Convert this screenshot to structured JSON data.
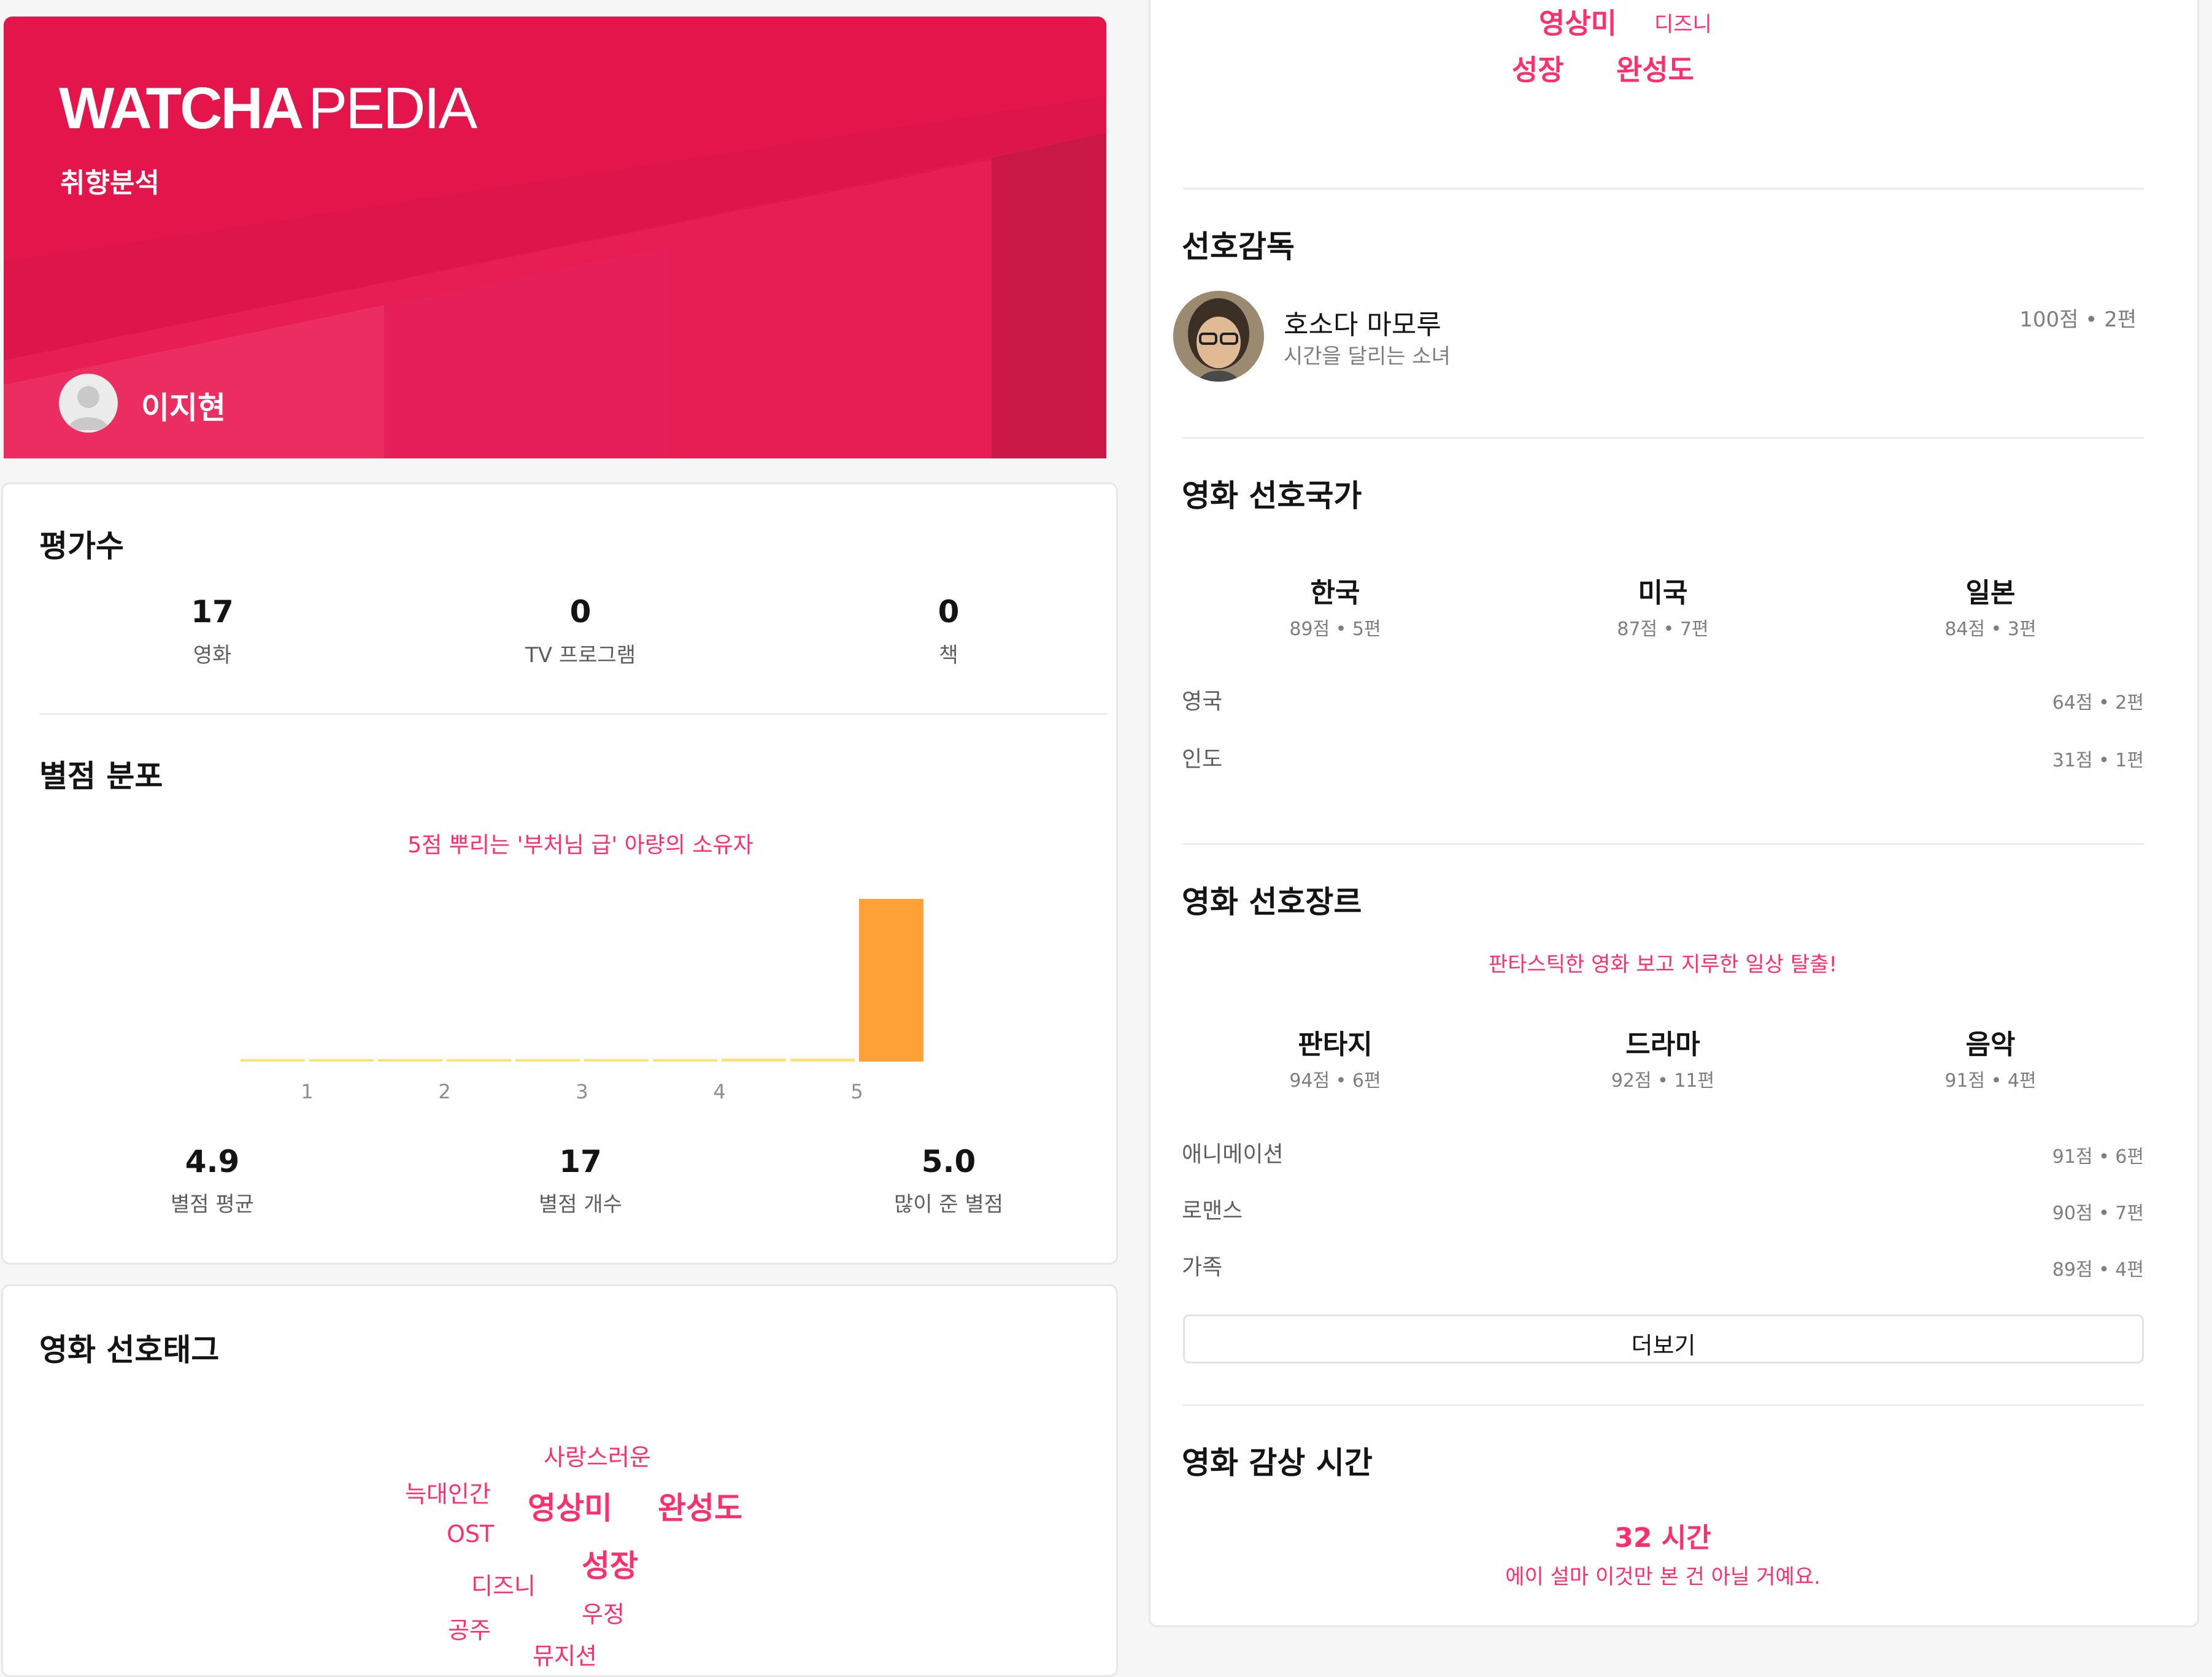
{
  "header": {
    "brand_watcha": "WATCHA",
    "brand_pedia": "PEDIA",
    "subtitle": "취향분석",
    "user_name": "이지현",
    "avatar_icon": "user-avatar-icon",
    "colors": {
      "primary": "#e4154b",
      "accent": "#ff2f6e"
    }
  },
  "ratings_count": {
    "title": "평가수",
    "items": [
      {
        "value": "17",
        "label": "영화"
      },
      {
        "value": "0",
        "label": "TV 프로그램"
      },
      {
        "value": "0",
        "label": "책"
      }
    ]
  },
  "star_distribution": {
    "title": "별점 분포",
    "comment": "5점 뿌리는 '부처님 급' 아량의 소유자",
    "stats": [
      {
        "value": "4.9",
        "label": "별점 평균"
      },
      {
        "value": "17",
        "label": "별점 개수"
      },
      {
        "value": "5.0",
        "label": "많이 준 별점"
      }
    ]
  },
  "chart_data": {
    "type": "bar",
    "categories": [
      "0.5",
      "1",
      "1.5",
      "2",
      "2.5",
      "3",
      "3.5",
      "4",
      "4.5",
      "5"
    ],
    "values": [
      0,
      0,
      0,
      0,
      0,
      0,
      0,
      0.3,
      0.3,
      16
    ],
    "tick_labels": [
      "1",
      "2",
      "3",
      "4",
      "5"
    ],
    "highlight_color": "#ffa136",
    "base_color": "#fde17a",
    "ylim": [
      0,
      16
    ]
  },
  "tags": {
    "title": "영화 선호태그",
    "items": [
      "사랑스러운",
      "늑대인간",
      "영상미",
      "완성도",
      "OST",
      "성장",
      "디즈니",
      "우정",
      "공주",
      "뮤지션"
    ]
  },
  "tags_top": {
    "items": [
      "영상미",
      "디즈니",
      "성장",
      "완성도"
    ]
  },
  "director": {
    "title": "선호감독",
    "name": "호소다 마모루",
    "work": "시간을 달리는 소녀",
    "stat": "100점 • 2편"
  },
  "countries": {
    "title": "영화 선호국가",
    "top": [
      {
        "name": "한국",
        "stat": "89점 • 5편"
      },
      {
        "name": "미국",
        "stat": "87점 • 7편"
      },
      {
        "name": "일본",
        "stat": "84점 • 3편"
      }
    ],
    "rest": [
      {
        "name": "영국",
        "stat": "64점 • 2편"
      },
      {
        "name": "인도",
        "stat": "31점 • 1편"
      }
    ]
  },
  "genres": {
    "title": "영화 선호장르",
    "comment": "판타스틱한 영화 보고 지루한 일상 탈출!",
    "top": [
      {
        "name": "판타지",
        "stat": "94점 • 6편"
      },
      {
        "name": "드라마",
        "stat": "92점 • 11편"
      },
      {
        "name": "음악",
        "stat": "91점 • 4편"
      }
    ],
    "rest": [
      {
        "name": "애니메이션",
        "stat": "91점 • 6편"
      },
      {
        "name": "로맨스",
        "stat": "90점 • 7편"
      },
      {
        "name": "가족",
        "stat": "89점 • 4편"
      }
    ],
    "more_button": "더보기"
  },
  "watch_time": {
    "title": "영화 감상 시간",
    "value": "32 시간",
    "comment": "에이 설마 이것만 본 건 아닐 거예요."
  }
}
